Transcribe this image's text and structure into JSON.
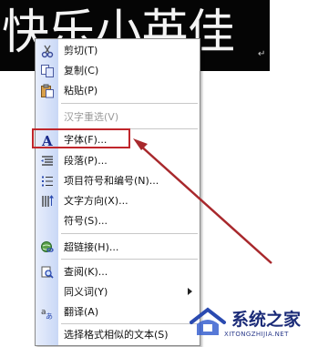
{
  "document": {
    "title_text": "快乐小英佳",
    "return_mark": "↵"
  },
  "menu": {
    "items": [
      {
        "label": "剪切(T)",
        "icon": "scissors-icon",
        "enabled": true
      },
      {
        "label": "复制(C)",
        "icon": "copy-icon",
        "enabled": true
      },
      {
        "label": "粘贴(P)",
        "icon": "paste-icon",
        "enabled": true
      },
      {
        "label": "汉字重选(V)",
        "icon": "",
        "enabled": false
      },
      {
        "label": "字体(F)...",
        "icon": "font-icon",
        "enabled": true
      },
      {
        "label": "段落(P)...",
        "icon": "paragraph-icon",
        "enabled": true
      },
      {
        "label": "项目符号和编号(N)...",
        "icon": "bullets-icon",
        "enabled": true
      },
      {
        "label": "文字方向(X)...",
        "icon": "text-direction-icon",
        "enabled": true
      },
      {
        "label": "符号(S)...",
        "icon": "",
        "enabled": true
      },
      {
        "label": "超链接(H)...",
        "icon": "hyperlink-icon",
        "enabled": true
      },
      {
        "label": "查阅(K)...",
        "icon": "lookup-icon",
        "enabled": true
      },
      {
        "label": "同义词(Y)",
        "icon": "",
        "enabled": true,
        "submenu": true
      },
      {
        "label": "翻译(A)",
        "icon": "translate-icon",
        "enabled": true
      },
      {
        "label": "选择格式相似的文本(S)",
        "icon": "",
        "enabled": true
      }
    ]
  },
  "annotation": {
    "highlight_color": "#c0262b",
    "highlighted_item": "字体(F)..."
  },
  "watermark": {
    "title": "系统之家",
    "url": "XITONGZHIJIA.NET"
  }
}
